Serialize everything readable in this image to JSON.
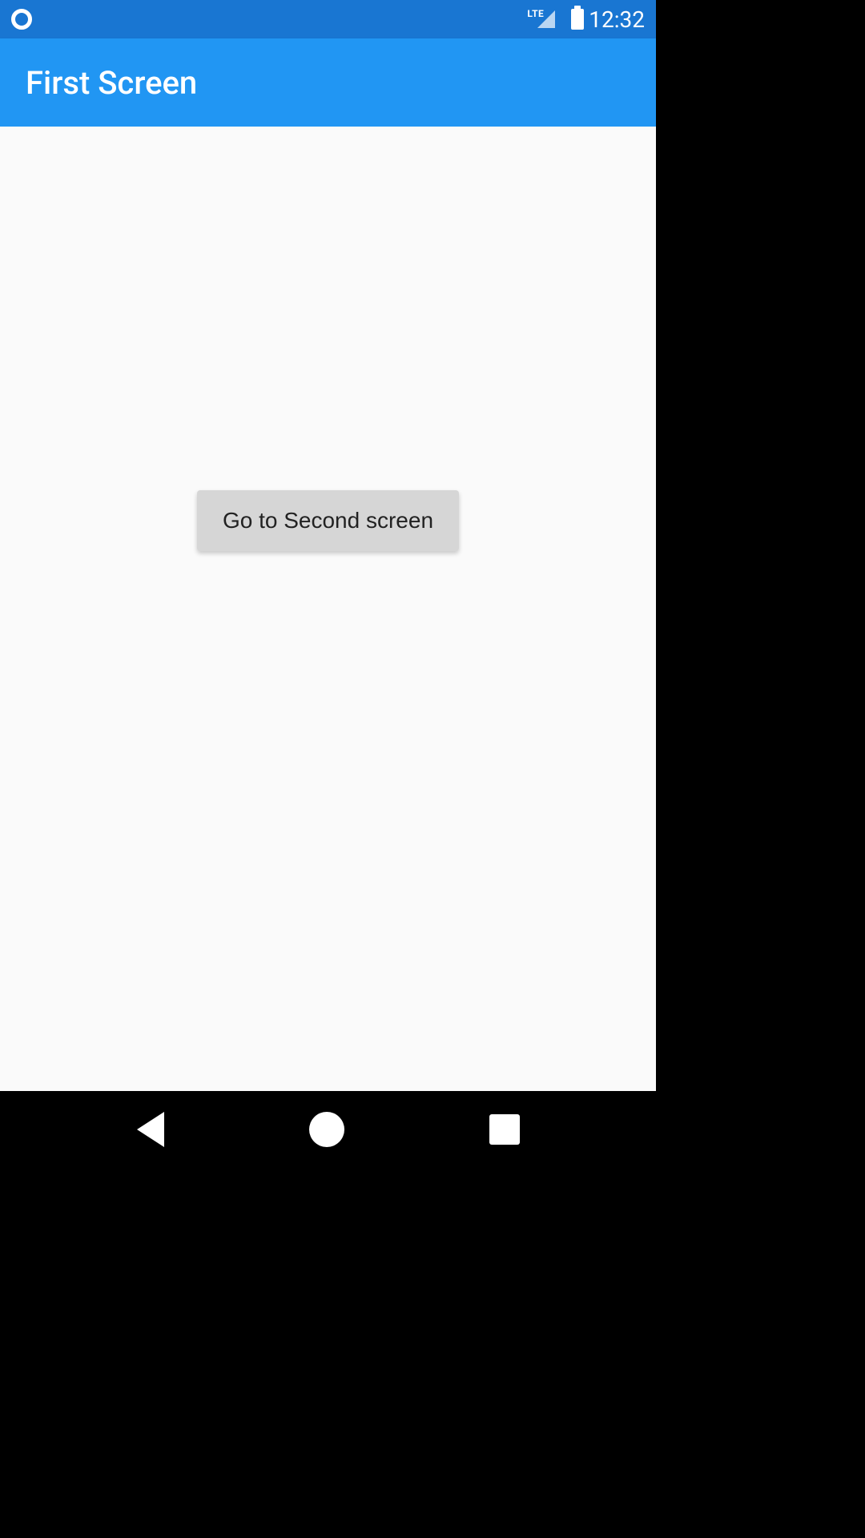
{
  "status_bar": {
    "network_type": "LTE",
    "time": "12:32"
  },
  "app_bar": {
    "title": "First Screen"
  },
  "content": {
    "button_label": "Go to Second screen"
  },
  "colors": {
    "status_bar_bg": "#1976d2",
    "app_bar_bg": "#2196f3",
    "content_bg": "#fafafa",
    "button_bg": "#d6d6d6"
  }
}
